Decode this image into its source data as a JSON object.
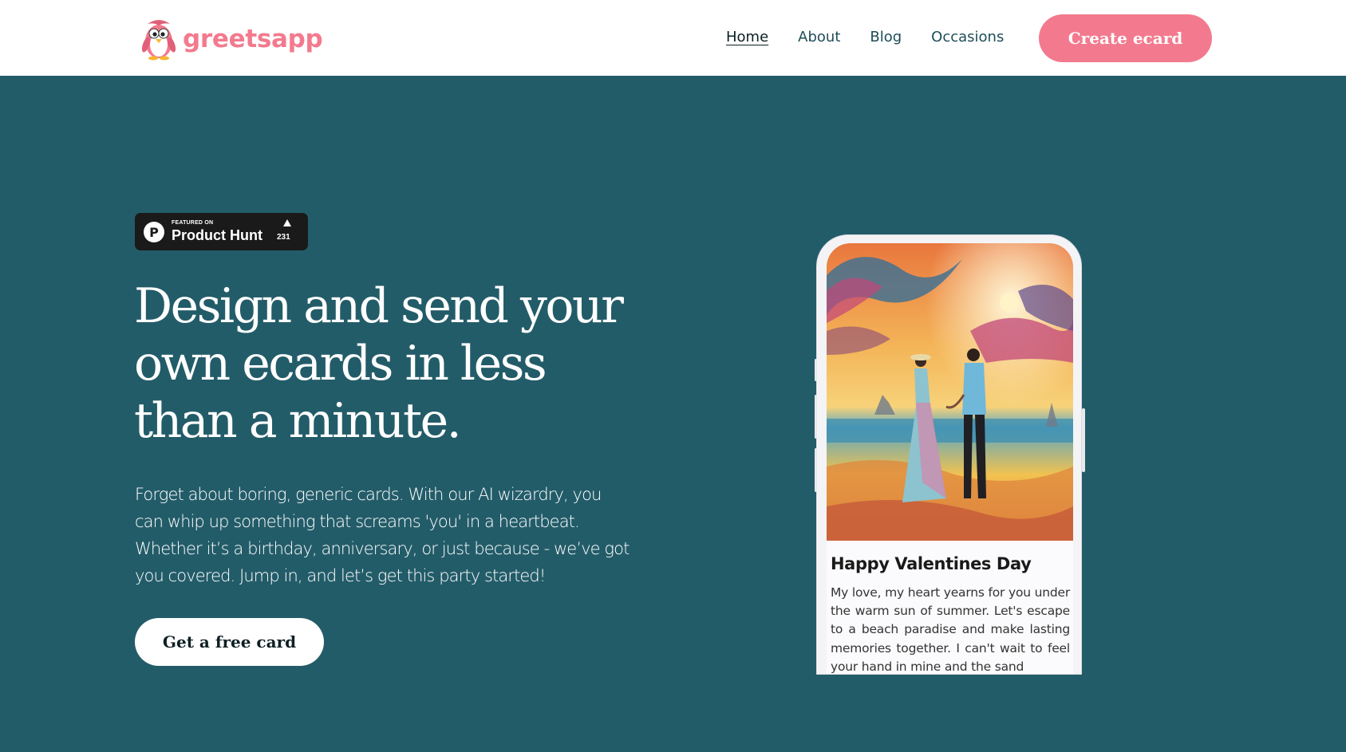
{
  "header": {
    "brand": "greetsapp",
    "nav": [
      {
        "label": "Home",
        "active": true
      },
      {
        "label": "About",
        "active": false
      },
      {
        "label": "Blog",
        "active": false
      },
      {
        "label": "Occasions",
        "active": false
      }
    ],
    "cta_label": "Create ecard"
  },
  "hero": {
    "badge": {
      "featured_label": "FEATURED ON",
      "platform": "Product Hunt",
      "count": "231"
    },
    "headline": "Design and send your own ecards in less than a minute.",
    "lead": "Forget about boring, generic cards. With our AI wizardry, you can whip up something that screams 'you' in a heartbeat. Whether it’s a birthday, anniversary, or just because - we’ve got you covered. Jump in, and let’s get this party started!",
    "button_label": "Get a free card"
  },
  "preview": {
    "card_title": "Happy Valentines Day",
    "card_body": "My love, my heart yearns for you under the warm sun of summer. Let's escape to a beach paradise and make lasting memories together. I can't wait to feel your hand in mine and the sand"
  },
  "colors": {
    "brand_pink": "#f37a8e",
    "hero_bg": "#235c69",
    "nav_text": "#1f4d59"
  }
}
